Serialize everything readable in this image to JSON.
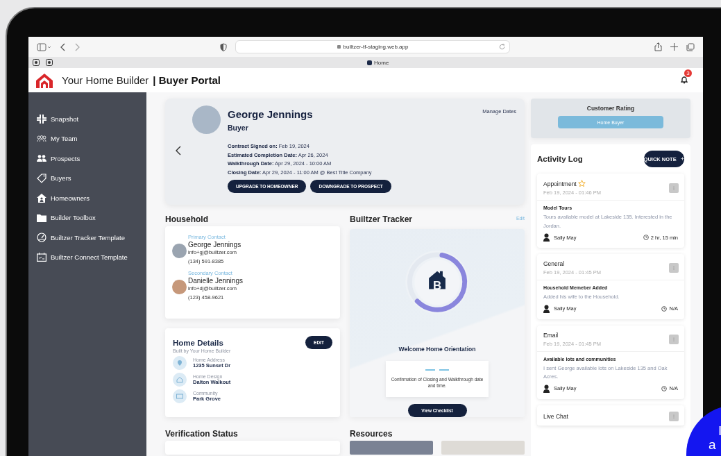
{
  "browser": {
    "url": "builtzer-tf-staging.web.app",
    "tab": "Home"
  },
  "header": {
    "brand": "Your Home Builder",
    "portal": "| Buyer Portal",
    "notifications": "3"
  },
  "sidebar": {
    "items": [
      {
        "label": "Snapshot"
      },
      {
        "label": "My Team"
      },
      {
        "label": "Prospects"
      },
      {
        "label": "Buyers"
      },
      {
        "label": "Homeowners"
      },
      {
        "label": "Builder Toolbox"
      },
      {
        "label": "Builtzer Tracker Template"
      },
      {
        "label": "Builtzer Connect Template"
      }
    ]
  },
  "profile": {
    "name": "George Jennings",
    "role": "Buyer",
    "manage": "Manage Dates",
    "dates": [
      {
        "label": "Contract Signed on:",
        "value": "Feb 19, 2024"
      },
      {
        "label": "Estimated Completion Date:",
        "value": "Apr 26, 2024"
      },
      {
        "label": "Walkthrough Date:",
        "value": "Apr 29, 2024 - 10:00 AM"
      },
      {
        "label": "Closing Date:",
        "value": "Apr 29, 2024 - 11:00 AM @ Best Title Company"
      }
    ],
    "buttons": [
      "UPGRADE TO HOMEOWNER",
      "DOWNGRADE TO PROSPECT"
    ]
  },
  "household": {
    "title": "Household",
    "contacts": [
      {
        "role": "Primary Contact",
        "name": "George Jennings",
        "email": "info+gj@builtzer.com",
        "phone": "(134) 591-8385"
      },
      {
        "role": "Secondary Contact",
        "name": "Danielle Jennings",
        "email": "info+dj@builtzer.com",
        "phone": "(123) 458-9621"
      }
    ]
  },
  "home_details": {
    "title": "Home Details",
    "edit": "EDIT",
    "subtitle": "Built by Your Home Builder",
    "fields": [
      {
        "label": "Home Address",
        "value": "1235 Sunset Dr"
      },
      {
        "label": "Home Design",
        "value": "Dalton Walkout"
      },
      {
        "label": "Community",
        "value": "Park Grove"
      }
    ]
  },
  "tracker": {
    "title": "Builtzer Tracker",
    "edit": "Edit",
    "level": 0.6,
    "logo_letter": "B",
    "step": "Welcome Home Orientation",
    "note": "Confirmation of Closing and Walkthrough date and time.",
    "button": "View Checklist"
  },
  "verification": {
    "title": "Verification Status"
  },
  "resources": {
    "title": "Resources"
  },
  "rating": {
    "title": "Customer Rating",
    "value": "Home Buyer"
  },
  "activity": {
    "title": "Activity Log",
    "button": "QUICK NOTE",
    "button_icon": "+",
    "entries": [
      {
        "type": "Appointment",
        "starred": true,
        "date": "Feb 19, 2024 - 01:46 PM",
        "subject": "Model Tours",
        "body": "Tours available model at Lakeside 135. Interested in the Jordan.",
        "author": "Sally May",
        "duration": "2 hr, 15 min"
      },
      {
        "type": "General",
        "starred": false,
        "date": "Feb 19, 2024 - 01:45 PM",
        "subject": "Household Memeber Added",
        "body": "Added his wife to the Household.",
        "author": "Sally May",
        "duration": "N/A"
      },
      {
        "type": "Email",
        "starred": false,
        "date": "Feb 19, 2024 - 01:45 PM",
        "subject": "Available lots and communities",
        "body": "I sent George available lots on Lakeside 135 and Oak Acres.",
        "author": "Sally May",
        "duration": "N/A"
      },
      {
        "type": "Live Chat",
        "starred": false
      }
    ]
  },
  "chat_bubble": {
    "lines": [
      "I",
      "a"
    ]
  }
}
